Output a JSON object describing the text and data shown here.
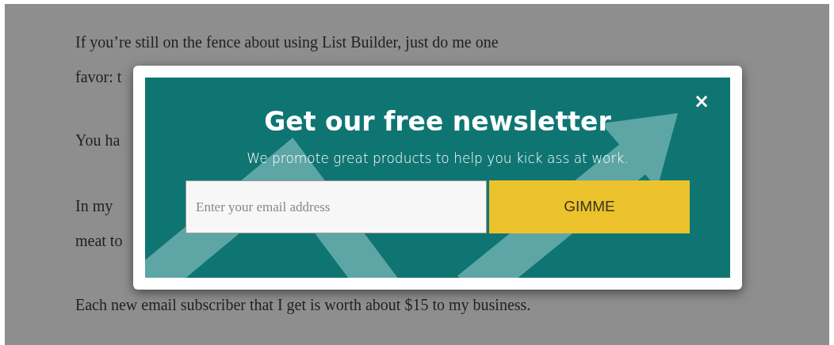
{
  "article": {
    "lines": [
      "If you’re still on the fence about using List Builder, just do me one",
      "favor: t",
      "You ha",
      "In my",
      "meat to",
      "Each new email subscriber that I get is worth about $15 to my business."
    ]
  },
  "popup": {
    "title": "Get our free newsletter",
    "subtitle": "We promote great products to help you kick ass at work.",
    "email": {
      "placeholder": "Enter your email address"
    },
    "button": "GIMME",
    "close": "×"
  }
}
